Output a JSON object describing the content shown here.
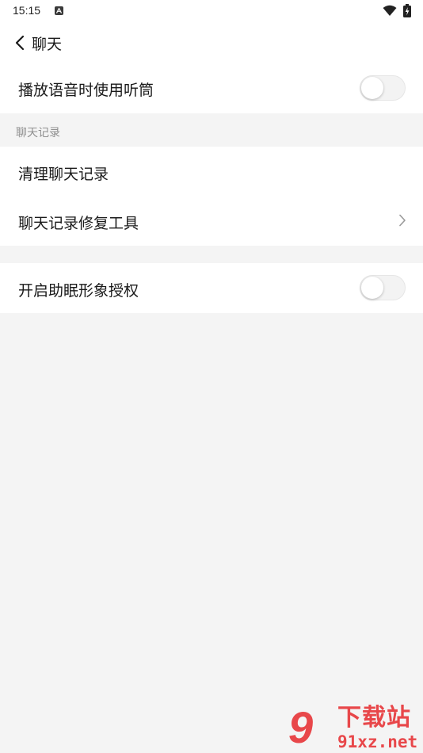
{
  "status_bar": {
    "time": "15:15",
    "icons": [
      "a-notification-icon",
      "wifi-icon",
      "battery-charging-icon"
    ]
  },
  "header": {
    "title": "聊天",
    "back_icon": "chevron-left-icon"
  },
  "settings": {
    "voice_earpiece": {
      "label": "播放语音时使用听筒",
      "enabled": false
    },
    "chat_history_section": "聊天记录",
    "clear_history": {
      "label": "清理聊天记录"
    },
    "repair_tool": {
      "label": "聊天记录修复工具"
    },
    "sleep_avatar": {
      "label": "开启助眠形象授权",
      "enabled": false
    }
  },
  "watermark": {
    "logo_number": "9",
    "site_name": "下载站",
    "domain": "91xz.net"
  },
  "colors": {
    "background": "#f4f4f4",
    "card": "#ffffff",
    "section_label": "#8f8f8f",
    "watermark": "#e8474a"
  }
}
